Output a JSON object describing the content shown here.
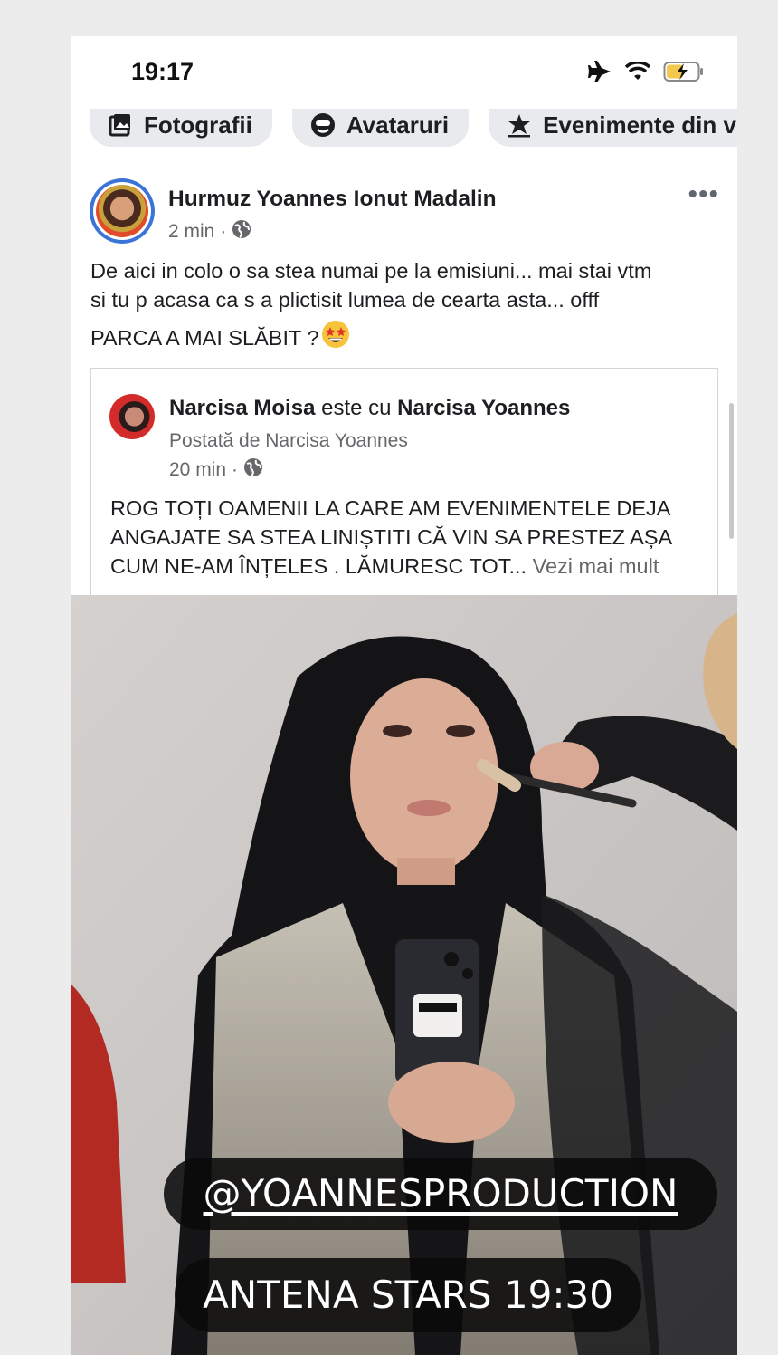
{
  "status_bar": {
    "time": "19:17",
    "icons": [
      "airplane-icon",
      "wifi-icon",
      "battery-charging-icon"
    ]
  },
  "chips": [
    {
      "label": "Fotografii",
      "icon": "photo-icon"
    },
    {
      "label": "Avataruri",
      "icon": "avatar-icon"
    },
    {
      "label": "Evenimente din v",
      "icon": "star-event-icon"
    }
  ],
  "post": {
    "author": "Hurmuz Yoannes Ionut Madalin",
    "time": "2 min",
    "separator": "·",
    "privacy_icon": "globe-icon",
    "more_label": "•••",
    "text_line1": "De aici in colo o sa stea numai pe la emisiuni... mai stai vtm",
    "text_line2": "si tu p acasa ca s a plictisit lumea de cearta asta... offf",
    "text_line3": "PARCA A MAI SLĂBIT ?",
    "emoji": "🤩"
  },
  "shared_post": {
    "author": "Narcisa Moisa",
    "connector": " este cu ",
    "tagged": "Narcisa Yoannes",
    "posted_by": "Postată de Narcisa Yoannes",
    "time": "20 min",
    "separator": "·",
    "privacy_icon": "globe-icon",
    "text_line1": "ROG TOȚI OAMENII LA CARE AM EVENIMENTELE DEJA",
    "text_line2": "ANGAJATE SA STEA LINIȘTITI CĂ VIN SA PRESTEZ AȘA",
    "text_line3": "CUM NE-AM ÎNȚELES . LĂMURESC TOT...",
    "see_more": "Vezi mai mult"
  },
  "photo": {
    "description_icon": "photo-image"
  },
  "story_tags": {
    "handle": "@YOANNESPRODUCTION",
    "show": "ANTENA STARS 19:30"
  },
  "colors": {
    "background": "#ececec",
    "card": "#ffffff",
    "chip_bg": "#e9eaee",
    "secondary_text": "#65676b",
    "avatar_ring": "#3b74d8",
    "tag_bg": "#0a0a0a"
  }
}
